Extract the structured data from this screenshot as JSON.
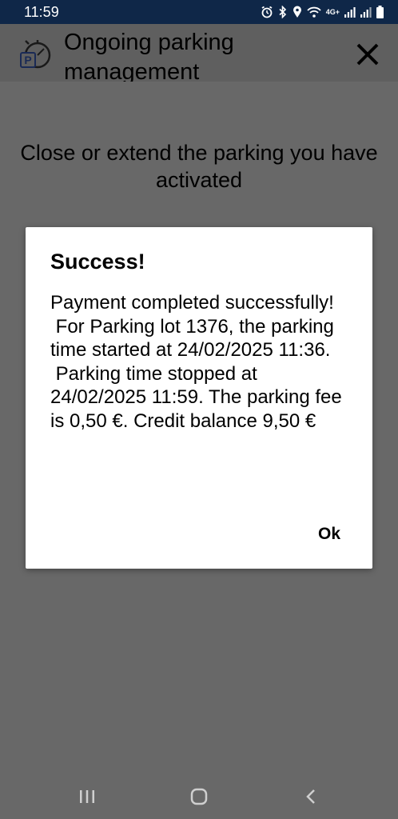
{
  "status_bar": {
    "time": "11:59",
    "network_label": "4G+",
    "icons": [
      "alarm-icon",
      "bluetooth-icon",
      "location-icon",
      "wifi-icon",
      "signal-icon",
      "signal-icon",
      "battery-icon"
    ]
  },
  "header": {
    "title": "Ongoing parking management",
    "logo_letter": "P",
    "close_icon": "close-icon"
  },
  "page": {
    "subtitle": "Close or extend the parking you have activated"
  },
  "dialog": {
    "title": "Success!",
    "message": "Payment completed successfully!\n For Parking lot 1376, the parking time started at 24/02/2025 11:36.\n Parking time stopped at 24/02/2025 11:59. The parking fee is 0,50 €. Credit balance 9,50 €",
    "ok_label": "Ok"
  },
  "nav_bar": {
    "icons": [
      "recent-apps-icon",
      "home-icon",
      "back-icon"
    ]
  },
  "colors": {
    "status_bar_bg": "#0f2748",
    "overlay_bg": "#686868",
    "header_bg": "#5f5f5f",
    "dialog_bg": "#ffffff",
    "text": "#000000"
  }
}
